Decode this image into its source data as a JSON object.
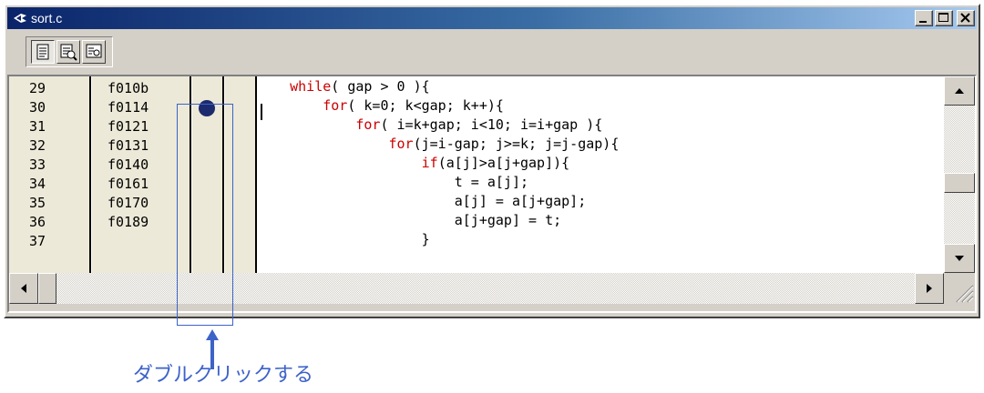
{
  "window": {
    "title": "sort.c"
  },
  "toolbar": {
    "buttons": [
      {
        "name": "source-view"
      },
      {
        "name": "mixed-view"
      },
      {
        "name": "disassembly-view"
      }
    ]
  },
  "gutter": {
    "rows": [
      {
        "line": "29",
        "address": "f010b",
        "breakpoint": false
      },
      {
        "line": "30",
        "address": "f0114",
        "breakpoint": true
      },
      {
        "line": "31",
        "address": "f0121",
        "breakpoint": false
      },
      {
        "line": "32",
        "address": "f0131",
        "breakpoint": false
      },
      {
        "line": "33",
        "address": "f0140",
        "breakpoint": false
      },
      {
        "line": "34",
        "address": "f0161",
        "breakpoint": false
      },
      {
        "line": "35",
        "address": "f0170",
        "breakpoint": false
      },
      {
        "line": "36",
        "address": "f0189",
        "breakpoint": false
      },
      {
        "line": "37",
        "address": "",
        "breakpoint": false
      }
    ]
  },
  "code": {
    "lines": [
      {
        "indent": "    ",
        "kw": "while",
        "rest": "( gap > 0 ){"
      },
      {
        "indent": "        ",
        "kw": "for",
        "rest": "( k=0; k<gap; k++){"
      },
      {
        "indent": "            ",
        "kw": "for",
        "rest": "( i=k+gap; i<10; i=i+gap ){"
      },
      {
        "indent": "                ",
        "kw": "for",
        "rest": "(j=i-gap; j>=k; j=j-gap){"
      },
      {
        "indent": "                    ",
        "kw": "if",
        "rest": "(a[j]>a[j+gap]){"
      },
      {
        "indent": "                        ",
        "kw": "",
        "rest": "t = a[j];"
      },
      {
        "indent": "                        ",
        "kw": "",
        "rest": "a[j] = a[j+gap];"
      },
      {
        "indent": "                        ",
        "kw": "",
        "rest": "a[j+gap] = t;"
      },
      {
        "indent": "                    ",
        "kw": "",
        "rest": "}"
      }
    ]
  },
  "annotation": {
    "text": "ダブルクリックする",
    "color": "#3d63c9"
  },
  "colors": {
    "keyword": "#cc0000",
    "titlebar": "#0a246a",
    "breakpoint": "#1c2a6e"
  }
}
